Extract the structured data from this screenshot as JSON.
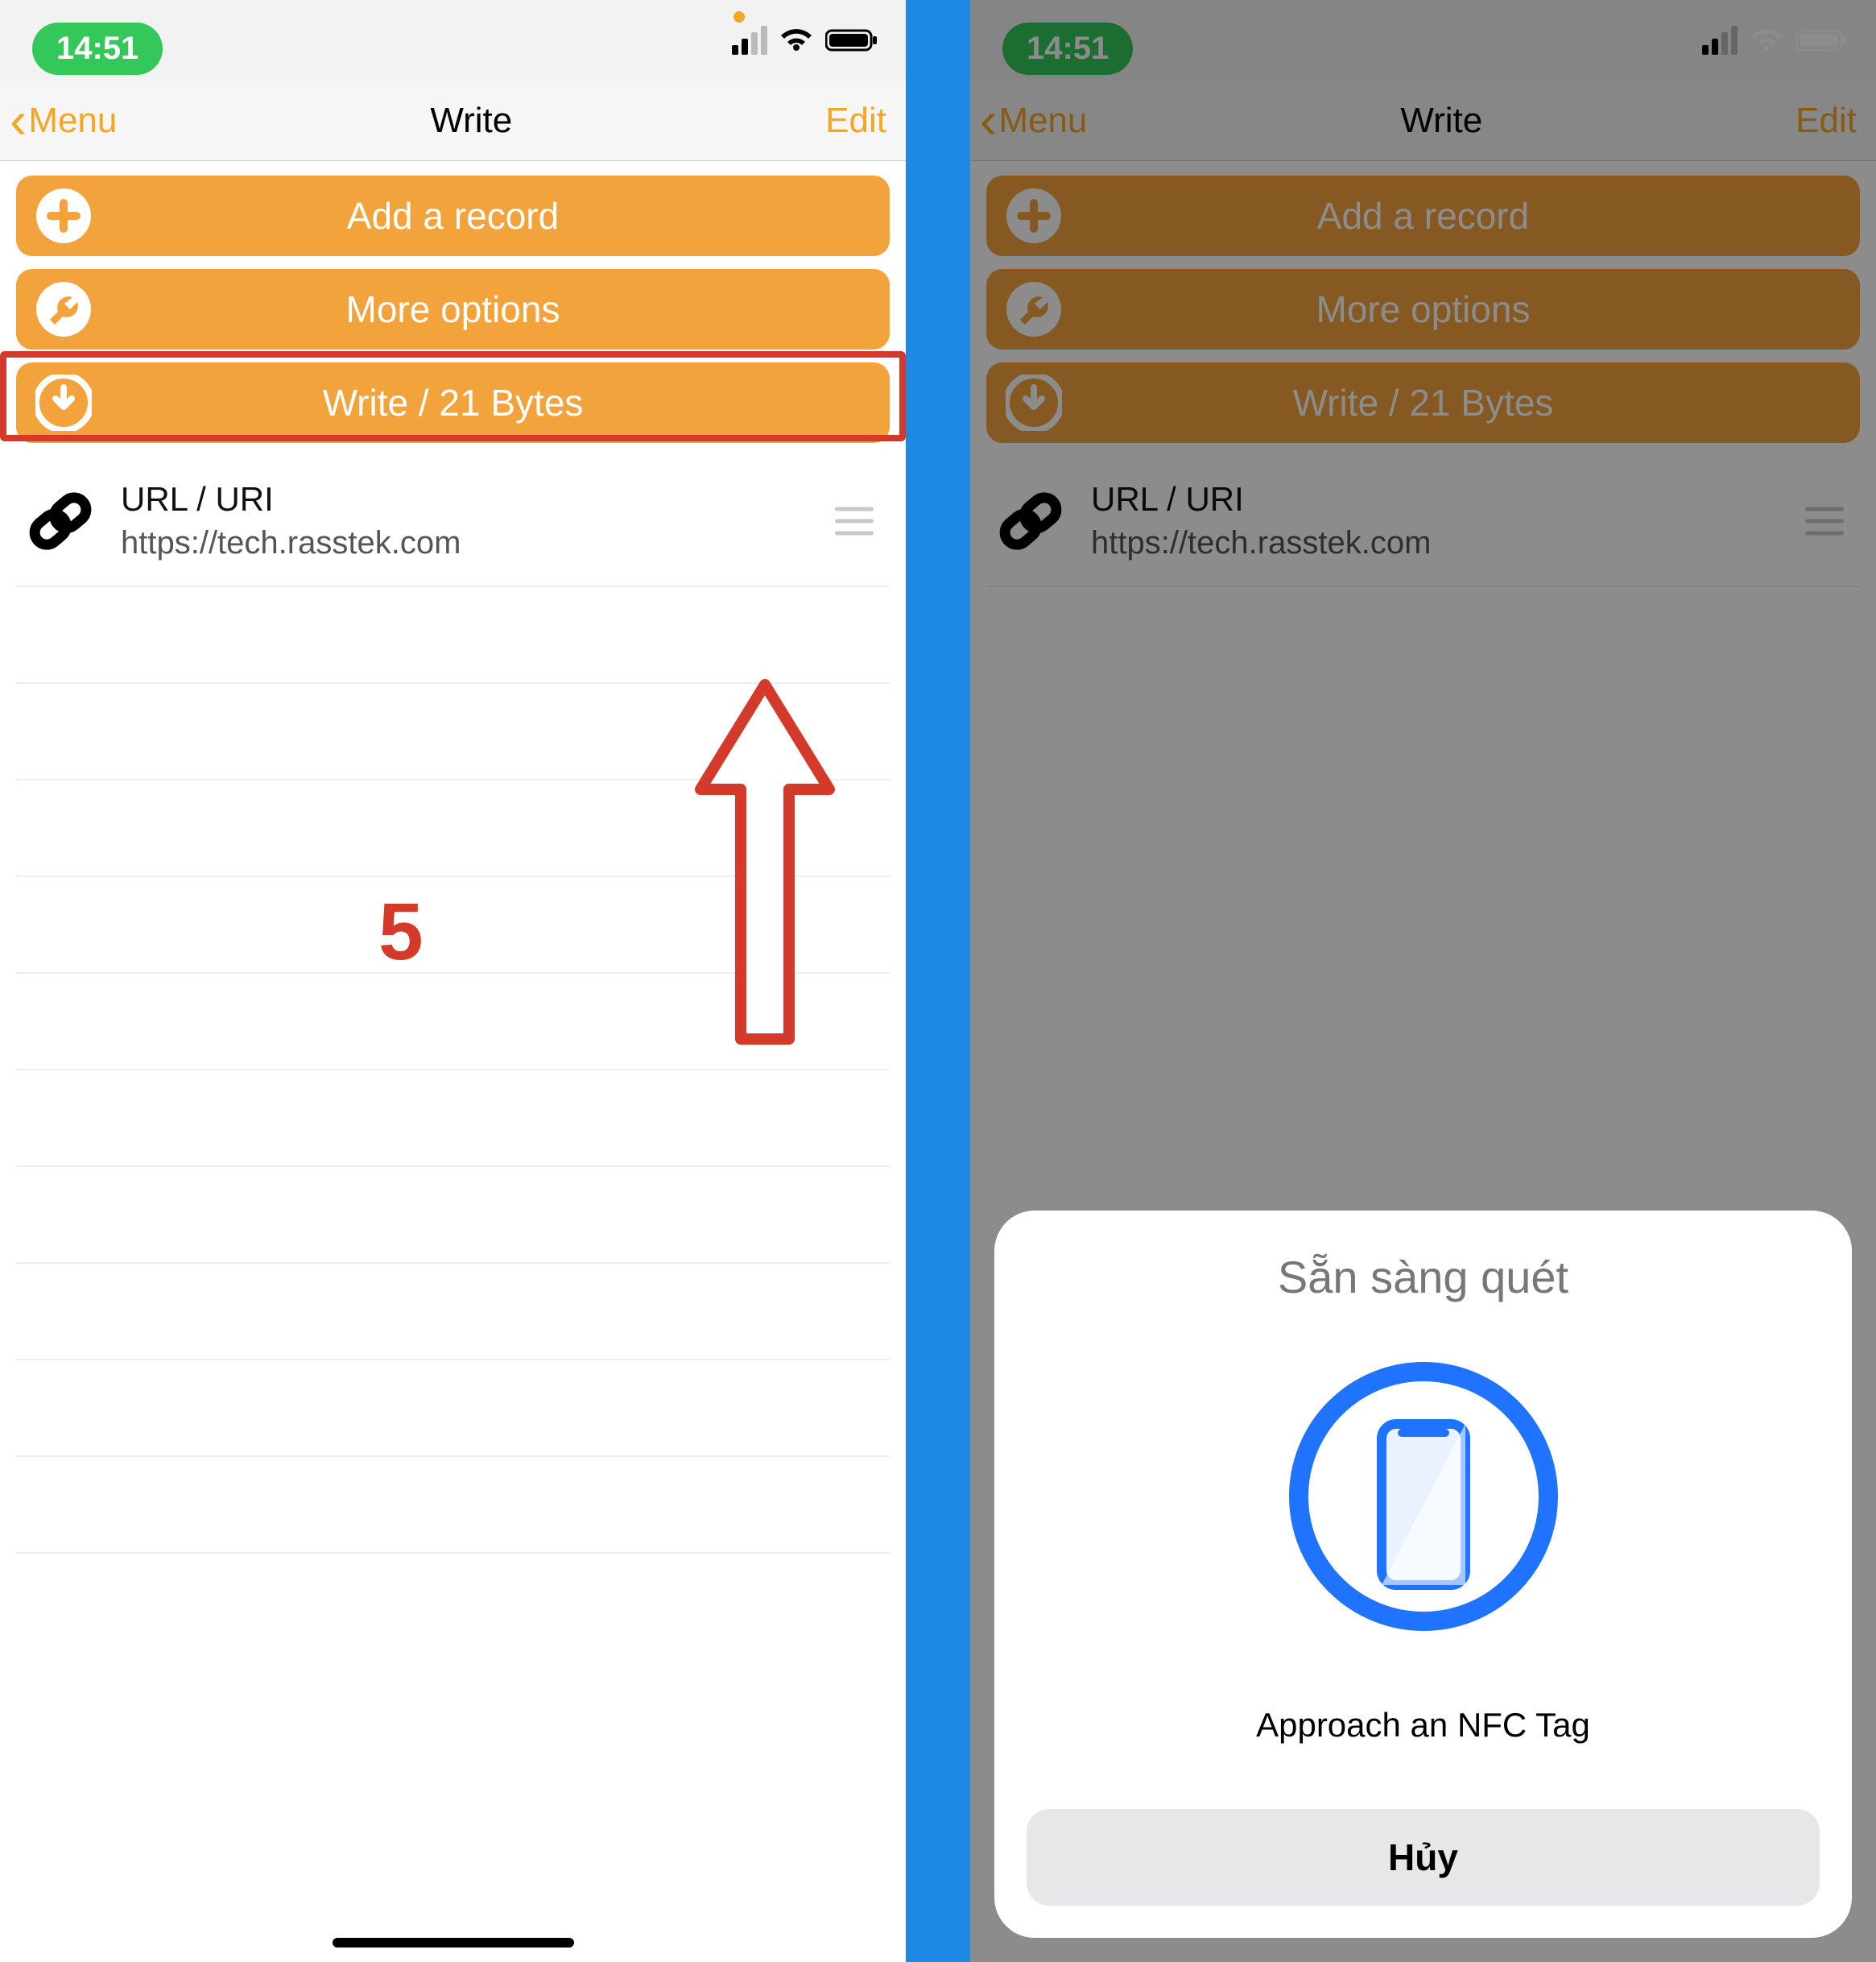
{
  "status": {
    "time": "14:51"
  },
  "nav": {
    "back_label": "Menu",
    "title": "Write",
    "edit_label": "Edit"
  },
  "buttons": {
    "add_record": "Add a record",
    "more_options": "More options",
    "write_bytes": "Write / 21 Bytes"
  },
  "record": {
    "title": "URL / URI",
    "url": "https://tech.rasstek.com"
  },
  "annotation": {
    "step_number": "5"
  },
  "nfc_sheet": {
    "title": "Sẵn sàng quét",
    "subtitle": "Approach an NFC Tag",
    "cancel": "Hủy"
  },
  "colors": {
    "accent": "#f5a623",
    "button": "#f2a33c",
    "highlight": "#d43a2a",
    "nfc_blue": "#1f73ff"
  }
}
